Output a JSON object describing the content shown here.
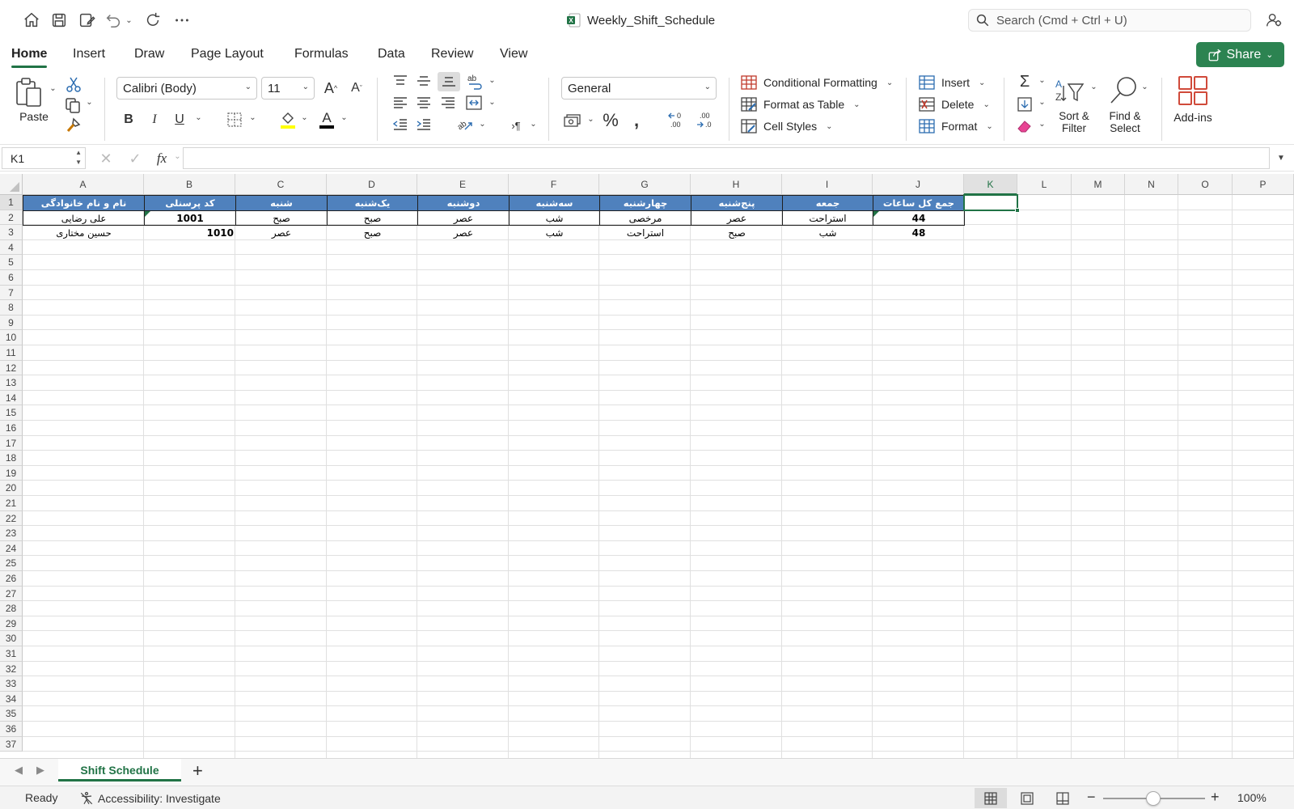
{
  "window": {
    "title": "Weekly_Shift_Schedule"
  },
  "search": {
    "placeholder": "Search (Cmd + Ctrl + U)"
  },
  "tabs": [
    "Home",
    "Insert",
    "Draw",
    "Page Layout",
    "Formulas",
    "Data",
    "Review",
    "View"
  ],
  "share": {
    "label": "Share"
  },
  "ribbon": {
    "paste": "Paste",
    "font_name": "Calibri (Body)",
    "font_size": "11",
    "bold": "B",
    "italic": "I",
    "underline": "U",
    "number_format": "General",
    "conditional_formatting": "Conditional Formatting",
    "format_as_table": "Format as Table",
    "cell_styles": "Cell Styles",
    "insert": "Insert",
    "delete": "Delete",
    "format": "Format",
    "sort_filter": [
      "Sort &",
      "Filter"
    ],
    "find_select": [
      "Find &",
      "Select"
    ],
    "add_ins": "Add-ins"
  },
  "formula_bar": {
    "name_box": "K1",
    "fx": "fx",
    "value": ""
  },
  "sheet": {
    "columns": [
      "A",
      "B",
      "C",
      "D",
      "E",
      "F",
      "G",
      "H",
      "I",
      "J",
      "K",
      "L",
      "M",
      "N",
      "O",
      "P"
    ],
    "selected_column": "K",
    "selected_row": 1,
    "row_count": 37,
    "header_row": [
      "نام و نام خانوادگی",
      "کد پرسنلی",
      "شنبه",
      "یک‌شنبه",
      "دوشنبه",
      "سه‌شنبه",
      "چهارشنبه",
      "پنج‌شنبه",
      "جمعه",
      "جمع کل ساعات"
    ],
    "rows": [
      [
        "علی رضایی",
        "1001",
        "صبح",
        "صبح",
        "عصر",
        "شب",
        "مرخصی",
        "عصر",
        "استراحت",
        "44"
      ],
      [
        "حسین مختاری",
        "1010",
        "عصر",
        "صبح",
        "عصر",
        "شب",
        "استراحت",
        "صبح",
        "شب",
        "48"
      ]
    ],
    "header_fill": "#4f81bd",
    "accent": "#217346"
  },
  "sheet_tabs": {
    "active": "Shift Schedule",
    "add": "+"
  },
  "status": {
    "ready": "Ready",
    "accessibility": "Accessibility: Investigate",
    "zoom": "100%"
  }
}
